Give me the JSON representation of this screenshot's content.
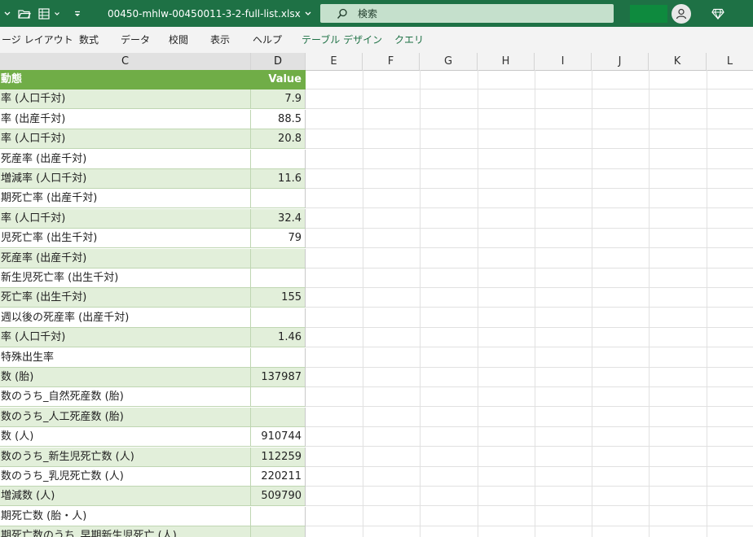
{
  "titlebar": {
    "filename": "00450-mhlw-00450011-3-2-full-list.xlsx",
    "search_label": "検索"
  },
  "ribbon": {
    "tabs": [
      "ージ レイアウト",
      "数式",
      "データ",
      "校閲",
      "表示",
      "ヘルプ",
      "テーブル デザイン",
      "クエリ"
    ]
  },
  "columns": [
    "C",
    "D",
    "E",
    "F",
    "G",
    "H",
    "I",
    "J",
    "K",
    "L"
  ],
  "table": {
    "header": {
      "label": "動態",
      "value": "Value"
    },
    "rows": [
      {
        "label": "率 (人口千対)",
        "value": "7.9"
      },
      {
        "label": "率 (出産千対)",
        "value": "88.5"
      },
      {
        "label": "率 (人口千対)",
        "value": "20.8"
      },
      {
        "label": "死産率 (出産千対)",
        "value": ""
      },
      {
        "label": "増減率 (人口千対)",
        "value": "11.6"
      },
      {
        "label": "期死亡率 (出産千対)",
        "value": ""
      },
      {
        "label": "率 (人口千対)",
        "value": "32.4"
      },
      {
        "label": "児死亡率 (出生千対)",
        "value": "79"
      },
      {
        "label": "死産率 (出産千対)",
        "value": ""
      },
      {
        "label": "新生児死亡率 (出生千対)",
        "value": ""
      },
      {
        "label": "死亡率 (出生千対)",
        "value": "155"
      },
      {
        "label": "週以後の死産率 (出産千対)",
        "value": ""
      },
      {
        "label": "率 (人口千対)",
        "value": "1.46"
      },
      {
        "label": "特殊出生率",
        "value": ""
      },
      {
        "label": "数 (胎)",
        "value": "137987"
      },
      {
        "label": "数のうち_自然死産数 (胎)",
        "value": ""
      },
      {
        "label": "数のうち_人工死産数 (胎)",
        "value": ""
      },
      {
        "label": "数 (人)",
        "value": "910744"
      },
      {
        "label": "数のうち_新生児死亡数 (人)",
        "value": "112259"
      },
      {
        "label": "数のうち_乳児死亡数 (人)",
        "value": "220211"
      },
      {
        "label": "増減数 (人)",
        "value": "509790"
      },
      {
        "label": "期死亡数 (胎・人)",
        "value": ""
      },
      {
        "label": "期死亡数のうち_早期新生児死亡 (人)",
        "value": ""
      }
    ]
  }
}
